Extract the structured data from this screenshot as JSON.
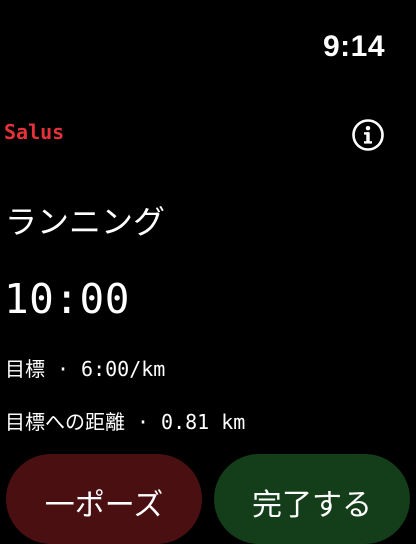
{
  "status_bar": {
    "time": "9:14"
  },
  "header": {
    "app_name": "Salus",
    "info_icon": "info-circle-icon"
  },
  "workout": {
    "title": "ランニング",
    "timer": "10:00",
    "pace": {
      "label": "目標",
      "separator": "·",
      "value": "6:00/km"
    },
    "distance": {
      "label": "目標への距離",
      "separator": "·",
      "value": "0.81 km"
    }
  },
  "actions": {
    "left_label": "一ポーズ",
    "right_label": "完了する"
  },
  "colors": {
    "background": "#000000",
    "accent": "#e5323a",
    "left_button": "#4a0f11",
    "right_button": "#143d1a"
  }
}
